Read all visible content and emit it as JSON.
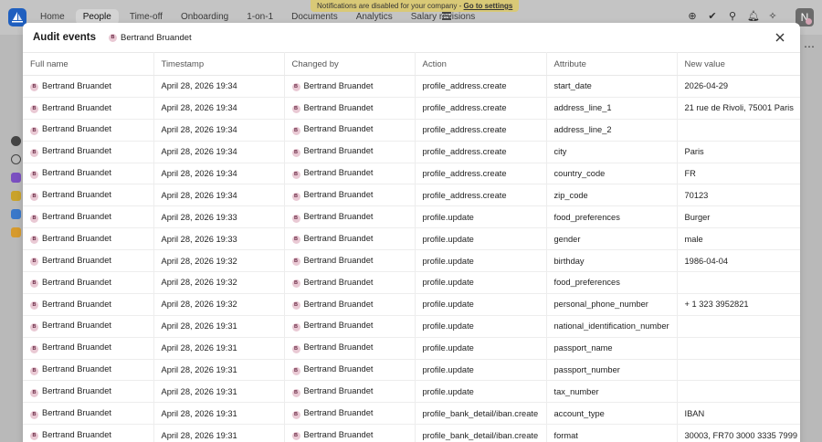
{
  "nav": {
    "items": [
      "Home",
      "People",
      "Time-off",
      "Onboarding",
      "1-on-1",
      "Documents",
      "Analytics",
      "Salary revisions"
    ],
    "active_index": 1
  },
  "notification": {
    "text": "Notifications are disabled for your company - ",
    "link": "Go to settings"
  },
  "profile_avatar_letter": "N",
  "modal": {
    "title": "Audit events",
    "filter_user": "Bertrand Bruandet",
    "filter_user_initial": "B",
    "columns": [
      "Full name",
      "Timestamp",
      "Changed by",
      "Action",
      "Attribute",
      "New value"
    ],
    "rows": [
      {
        "full_name": "Bertrand Bruandet",
        "timestamp": "April 28, 2026 19:34",
        "changed_by": "Bertrand Bruandet",
        "action": "profile_address.create",
        "attribute": "start_date",
        "new_value": "2026-04-29"
      },
      {
        "full_name": "Bertrand Bruandet",
        "timestamp": "April 28, 2026 19:34",
        "changed_by": "Bertrand Bruandet",
        "action": "profile_address.create",
        "attribute": "address_line_1",
        "new_value": "21 rue de Rivoli, 75001 Paris"
      },
      {
        "full_name": "Bertrand Bruandet",
        "timestamp": "April 28, 2026 19:34",
        "changed_by": "Bertrand Bruandet",
        "action": "profile_address.create",
        "attribute": "address_line_2",
        "new_value": ""
      },
      {
        "full_name": "Bertrand Bruandet",
        "timestamp": "April 28, 2026 19:34",
        "changed_by": "Bertrand Bruandet",
        "action": "profile_address.create",
        "attribute": "city",
        "new_value": "Paris"
      },
      {
        "full_name": "Bertrand Bruandet",
        "timestamp": "April 28, 2026 19:34",
        "changed_by": "Bertrand Bruandet",
        "action": "profile_address.create",
        "attribute": "country_code",
        "new_value": "FR"
      },
      {
        "full_name": "Bertrand Bruandet",
        "timestamp": "April 28, 2026 19:34",
        "changed_by": "Bertrand Bruandet",
        "action": "profile_address.create",
        "attribute": "zip_code",
        "new_value": "70123"
      },
      {
        "full_name": "Bertrand Bruandet",
        "timestamp": "April 28, 2026 19:33",
        "changed_by": "Bertrand Bruandet",
        "action": "profile.update",
        "attribute": "food_preferences",
        "new_value": "Burger"
      },
      {
        "full_name": "Bertrand Bruandet",
        "timestamp": "April 28, 2026 19:33",
        "changed_by": "Bertrand Bruandet",
        "action": "profile.update",
        "attribute": "gender",
        "new_value": "male"
      },
      {
        "full_name": "Bertrand Bruandet",
        "timestamp": "April 28, 2026 19:32",
        "changed_by": "Bertrand Bruandet",
        "action": "profile.update",
        "attribute": "birthday",
        "new_value": "1986-04-04"
      },
      {
        "full_name": "Bertrand Bruandet",
        "timestamp": "April 28, 2026 19:32",
        "changed_by": "Bertrand Bruandet",
        "action": "profile.update",
        "attribute": "food_preferences",
        "new_value": ""
      },
      {
        "full_name": "Bertrand Bruandet",
        "timestamp": "April 28, 2026 19:32",
        "changed_by": "Bertrand Bruandet",
        "action": "profile.update",
        "attribute": "personal_phone_number",
        "new_value": "+ 1 323 3952821"
      },
      {
        "full_name": "Bertrand Bruandet",
        "timestamp": "April 28, 2026 19:31",
        "changed_by": "Bertrand Bruandet",
        "action": "profile.update",
        "attribute": "national_identification_number",
        "new_value": ""
      },
      {
        "full_name": "Bertrand Bruandet",
        "timestamp": "April 28, 2026 19:31",
        "changed_by": "Bertrand Bruandet",
        "action": "profile.update",
        "attribute": "passport_name",
        "new_value": ""
      },
      {
        "full_name": "Bertrand Bruandet",
        "timestamp": "April 28, 2026 19:31",
        "changed_by": "Bertrand Bruandet",
        "action": "profile.update",
        "attribute": "passport_number",
        "new_value": ""
      },
      {
        "full_name": "Bertrand Bruandet",
        "timestamp": "April 28, 2026 19:31",
        "changed_by": "Bertrand Bruandet",
        "action": "profile.update",
        "attribute": "tax_number",
        "new_value": ""
      },
      {
        "full_name": "Bertrand Bruandet",
        "timestamp": "April 28, 2026 19:31",
        "changed_by": "Bertrand Bruandet",
        "action": "profile_bank_detail/iban.create",
        "attribute": "account_type",
        "new_value": "IBAN"
      },
      {
        "full_name": "Bertrand Bruandet",
        "timestamp": "April 28, 2026 19:31",
        "changed_by": "Bertrand Bruandet",
        "action": "profile_bank_detail/iban.create",
        "attribute": "format",
        "new_value": "30003, FR70 3000 3335 7999"
      }
    ]
  }
}
